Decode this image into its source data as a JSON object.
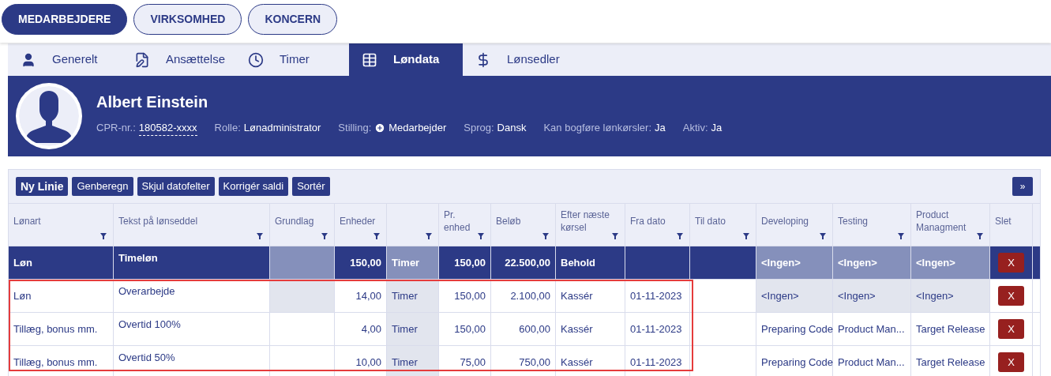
{
  "top_nav": [
    {
      "label": "MEDARBEJDERE",
      "selected": true
    },
    {
      "label": "VIRKSOMHED",
      "selected": false
    },
    {
      "label": "KONCERN",
      "selected": false
    }
  ],
  "tabs": [
    {
      "label": "Generelt",
      "selected": false
    },
    {
      "label": "Ansættelse",
      "selected": false
    },
    {
      "label": "Timer",
      "selected": false
    },
    {
      "label": "Løndata",
      "selected": true
    },
    {
      "label": "Lønsedler",
      "selected": false
    }
  ],
  "profile": {
    "name": "Albert Einstein",
    "fields": [
      {
        "label": "CPR-nr.:",
        "value": "180582-xxxx",
        "kind": "dashed"
      },
      {
        "label": "Rolle:",
        "value": "Lønadministrator",
        "kind": "plain"
      },
      {
        "label": "Stilling:",
        "value": "Medarbejder",
        "kind": "plus"
      },
      {
        "label": "Sprog:",
        "value": "Dansk",
        "kind": "plain"
      },
      {
        "label": "Kan bogføre lønkørsler:",
        "value": "Ja",
        "kind": "plain"
      },
      {
        "label": "Aktiv:",
        "value": "Ja",
        "kind": "plain"
      }
    ]
  },
  "toolbar": {
    "buttons": [
      {
        "label": "Ny Linie",
        "primary": true
      },
      {
        "label": "Genberegn",
        "primary": false
      },
      {
        "label": "Skjul datofelter",
        "primary": false
      },
      {
        "label": "Korrigér saldi",
        "primary": false
      },
      {
        "label": "Sortér",
        "primary": false
      }
    ],
    "expand": "»"
  },
  "table": {
    "columns": [
      {
        "label": "Lønart"
      },
      {
        "label": "Tekst på lønseddel"
      },
      {
        "label": "Grundlag"
      },
      {
        "label": "Enheder"
      },
      {},
      {
        "label": "Pr. enhed"
      },
      {
        "label": "Beløb"
      },
      {
        "label": "Efter næste kørsel"
      },
      {
        "label": "Fra dato"
      },
      {
        "label": "Til dato"
      },
      {
        "label": "Developing"
      },
      {
        "label": "Testing"
      },
      {
        "label": "Product Managment"
      },
      {
        "label": "Slet"
      }
    ],
    "rows": [
      {
        "selected": true,
        "highlighted": false,
        "cells": [
          {
            "text": "Løn",
            "shaded": false
          },
          {
            "text": "Timeløn",
            "shaded": false
          },
          {
            "shaded": true
          },
          {
            "text": "150,00",
            "shaded": false
          },
          {
            "text": "Timer",
            "shaded": true
          },
          {
            "text": "150,00",
            "shaded": false
          },
          {
            "text": "22.500,00",
            "shaded": false
          },
          {
            "text": "Behold",
            "shaded": false
          },
          {
            "shaded": false
          },
          {
            "shaded": false
          },
          {
            "text": "<Ingen>",
            "shaded": true
          },
          {
            "text": "<Ingen>",
            "shaded": true
          },
          {
            "text": "<Ingen>",
            "shaded": true
          },
          {
            "text": "X",
            "shaded": false
          }
        ]
      },
      {
        "selected": false,
        "highlighted": true,
        "cells": [
          {
            "text": "Løn",
            "shaded": false
          },
          {
            "text": "Overarbejde",
            "shaded": false
          },
          {
            "shaded": true
          },
          {
            "text": "14,00",
            "shaded": false
          },
          {
            "text": "Timer",
            "shaded": true
          },
          {
            "text": "150,00",
            "shaded": false
          },
          {
            "text": "2.100,00",
            "shaded": false
          },
          {
            "text": "Kassér",
            "shaded": false
          },
          {
            "text": "01-11-2023",
            "shaded": false
          },
          {
            "shaded": false
          },
          {
            "text": "<Ingen>",
            "shaded": true
          },
          {
            "text": "<Ingen>",
            "shaded": true
          },
          {
            "text": "<Ingen>",
            "shaded": true
          },
          {
            "text": "X",
            "shaded": false
          }
        ]
      },
      {
        "selected": false,
        "highlighted": true,
        "cells": [
          {
            "text": "Tillæg, bonus mm.",
            "shaded": false
          },
          {
            "text": "Overtid 100%",
            "shaded": false
          },
          {
            "shaded": false
          },
          {
            "text": "4,00",
            "shaded": false
          },
          {
            "text": "Timer",
            "shaded": true
          },
          {
            "text": "150,00",
            "shaded": false
          },
          {
            "text": "600,00",
            "shaded": false
          },
          {
            "text": "Kassér",
            "shaded": false
          },
          {
            "text": "01-11-2023",
            "shaded": false
          },
          {
            "shaded": false
          },
          {
            "text": "Preparing Code",
            "shaded": false
          },
          {
            "text": "Product Man...",
            "shaded": false
          },
          {
            "text": "Target Release",
            "shaded": false
          },
          {
            "text": "X",
            "shaded": false
          }
        ]
      },
      {
        "selected": false,
        "highlighted": true,
        "cells": [
          {
            "text": "Tillæg, bonus mm.",
            "shaded": false
          },
          {
            "text": "Overtid 50%",
            "shaded": false
          },
          {
            "shaded": false
          },
          {
            "text": "10,00",
            "shaded": false
          },
          {
            "text": "Timer",
            "shaded": true
          },
          {
            "text": "75,00",
            "shaded": false
          },
          {
            "text": "750,00",
            "shaded": false
          },
          {
            "text": "Kassér",
            "shaded": false
          },
          {
            "text": "01-11-2023",
            "shaded": false
          },
          {
            "shaded": false
          },
          {
            "text": "Preparing Code",
            "shaded": false
          },
          {
            "text": "Product Man...",
            "shaded": false
          },
          {
            "text": "Target Release",
            "shaded": false
          },
          {
            "text": "X",
            "shaded": false
          }
        ]
      }
    ]
  }
}
